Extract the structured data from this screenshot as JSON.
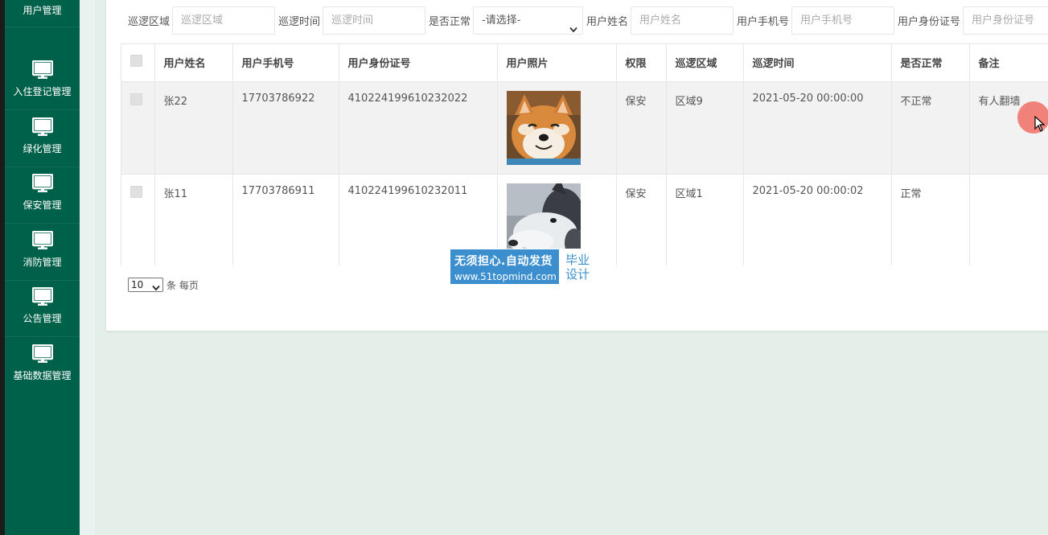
{
  "sidebar": {
    "items": [
      {
        "label": "用户管理",
        "icon": "monitor-icon"
      },
      {
        "label": "入住登记管理",
        "icon": "monitor-icon"
      },
      {
        "label": "绿化管理",
        "icon": "monitor-icon"
      },
      {
        "label": "保安管理",
        "icon": "monitor-icon"
      },
      {
        "label": "消防管理",
        "icon": "monitor-icon"
      },
      {
        "label": "公告管理",
        "icon": "monitor-icon"
      },
      {
        "label": "基础数据管理",
        "icon": "monitor-icon"
      }
    ]
  },
  "filters": {
    "area_label": "巡逻区域",
    "area_placeholder": "巡逻区域",
    "time_label": "巡逻时间",
    "time_placeholder": "巡逻时间",
    "normal_label": "是否正常",
    "normal_selected": "-请选择-",
    "name_label": "用户姓名",
    "name_placeholder": "用户姓名",
    "phone_label": "用户手机号",
    "phone_placeholder": "用户手机号",
    "idcard_label": "用户身份证号",
    "idcard_placeholder": "用户身份证号"
  },
  "table": {
    "headers": [
      "用户姓名",
      "用户手机号",
      "用户身份证号",
      "用户照片",
      "权限",
      "巡逻区域",
      "巡逻时间",
      "是否正常",
      "备注"
    ],
    "rows": [
      {
        "name": "张22",
        "phone": "17703786922",
        "idcard": "410224199610232022",
        "photo": "shiba-dog-photo",
        "role": "保安",
        "area": "区域9",
        "time": "2021-05-20 00:00:00",
        "normal": "不正常",
        "note": "有人翻墙"
      },
      {
        "name": "张11",
        "phone": "17703786911",
        "idcard": "410224199610232011",
        "photo": "husky-dog-photo",
        "role": "保安",
        "area": "区域1",
        "time": "2021-05-20 00:00:02",
        "normal": "正常",
        "note": ""
      }
    ]
  },
  "pager": {
    "page_size": "10",
    "page_size_suffix": "条 每页"
  },
  "watermark": {
    "main": "无须担心.自动发货",
    "url": "www.51topmind.com",
    "right_line1": "毕业",
    "right_line2": "设计"
  },
  "colors": {
    "sidebar_bg": "#00614a",
    "page_bg": "#e4efea",
    "watermark_bg": "#3b8fcf"
  }
}
